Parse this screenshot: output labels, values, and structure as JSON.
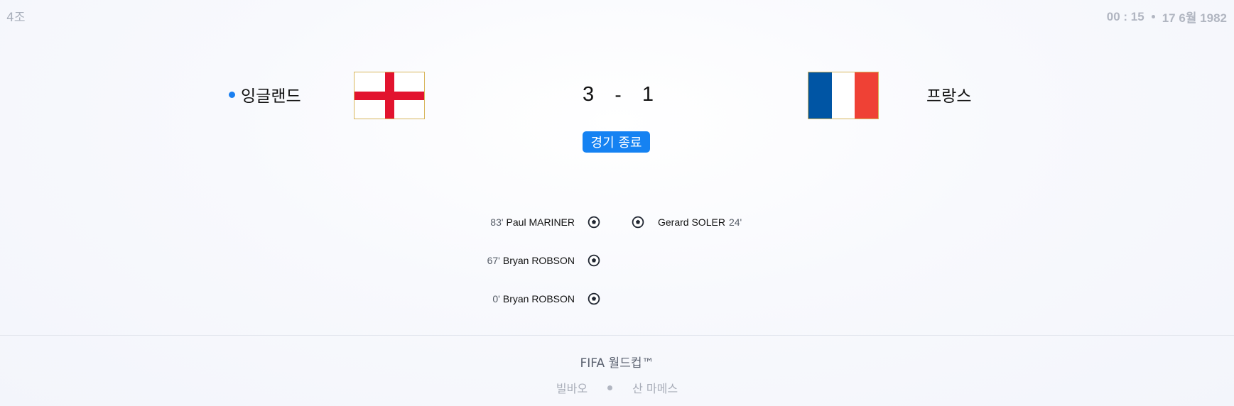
{
  "header": {
    "group": "4조",
    "time": "00 : 15",
    "date": "17 6월 1982"
  },
  "match": {
    "home": {
      "name": "잉글랜드",
      "flag": "england-flag-icon",
      "score": "3"
    },
    "away": {
      "name": "프랑스",
      "flag": "france-flag-icon",
      "score": "1"
    },
    "separator": "-",
    "status": "경기 종료"
  },
  "goals": {
    "home": [
      {
        "minute": "83'",
        "player": "Paul MARINER"
      },
      {
        "minute": "67'",
        "player": "Bryan ROBSON"
      },
      {
        "minute": "0'",
        "player": "Bryan ROBSON"
      }
    ],
    "away": [
      {
        "minute": "24'",
        "player": "Gerard SOLER"
      }
    ],
    "icon": "soccer-ball-icon"
  },
  "footer": {
    "competition": "FIFA 월드컵™",
    "city": "빌바오",
    "stadium": "산 마메스"
  },
  "colors": {
    "accent": "#1582f2",
    "england_red": "#e2132e",
    "france_blue": "#0055a4",
    "france_red": "#ef4135"
  }
}
